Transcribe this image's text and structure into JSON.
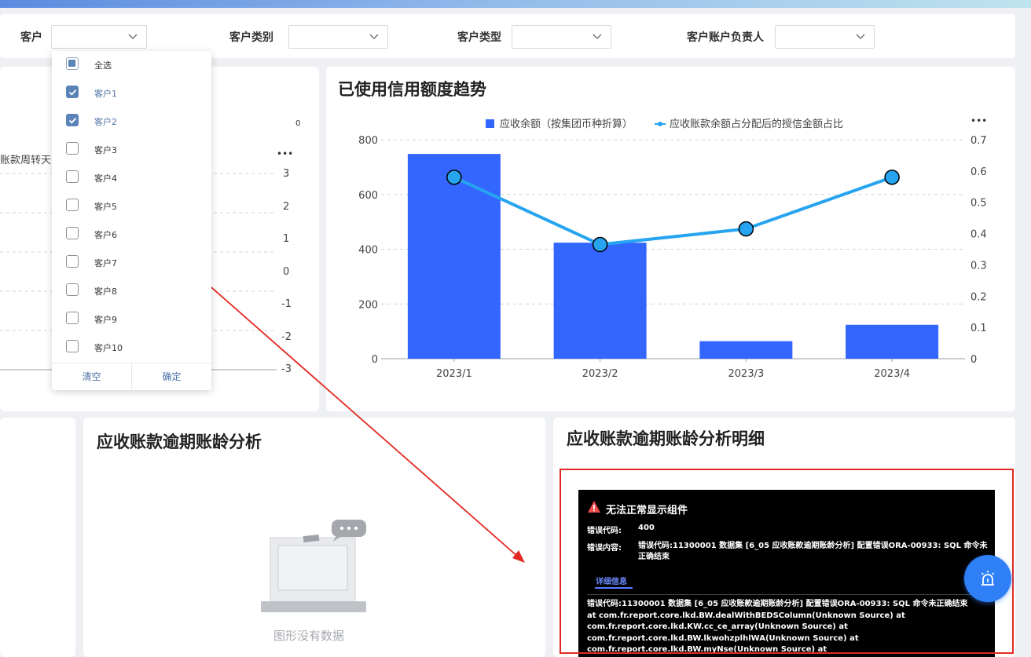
{
  "filters": {
    "customer_label": "客户",
    "category_label": "客户类别",
    "type_label": "客户类型",
    "owner_label": "客户账户负责人"
  },
  "dropdown": {
    "select_all": "全选",
    "items": [
      {
        "label": "客户1",
        "checked": true
      },
      {
        "label": "客户2",
        "checked": true
      },
      {
        "label": "客户3",
        "checked": false
      },
      {
        "label": "客户4",
        "checked": false
      },
      {
        "label": "客户5",
        "checked": false
      },
      {
        "label": "客户6",
        "checked": false
      },
      {
        "label": "客户7",
        "checked": false
      },
      {
        "label": "客户8",
        "checked": false
      },
      {
        "label": "客户9",
        "checked": false
      },
      {
        "label": "客户10",
        "checked": false
      }
    ],
    "clear_label": "清空",
    "confirm_label": "确定"
  },
  "left_chart": {
    "corner_value": "0",
    "axis_label_partial": "账款周转天",
    "more": "•••",
    "right_ticks": [
      "3",
      "2",
      "1",
      "0",
      "-1",
      "-2",
      "-3"
    ]
  },
  "credit_chart": {
    "title": "已使用信用额度趋势",
    "more": "•••",
    "chart_data": {
      "type": "bar",
      "categories": [
        "2023/1",
        "2023/2",
        "2023/3",
        "2023/4"
      ],
      "series": [
        {
          "name": "应收余额（按集团币种折算）",
          "type": "bar",
          "axis": "left",
          "values": [
            748,
            424,
            64,
            124
          ]
        },
        {
          "name": "应收账款余额占分配后的授信金额占比",
          "type": "line",
          "axis": "right",
          "values": [
            0.58,
            0.365,
            0.415,
            0.58
          ]
        }
      ],
      "y_left": {
        "ticks": [
          "0",
          "200",
          "400",
          "600",
          "800"
        ],
        "range": [
          0,
          800
        ]
      },
      "y_right": {
        "ticks": [
          "0",
          "0.1",
          "0.2",
          "0.3",
          "0.4",
          "0.5",
          "0.6",
          "0.7"
        ],
        "range": [
          0,
          0.7
        ]
      },
      "grid": true,
      "legend": "top",
      "colors": {
        "bar": "#3366ff",
        "line": "#26a4f0"
      }
    }
  },
  "aging_card": {
    "title": "应收账款逾期账龄分析",
    "empty_text": "图形没有数据"
  },
  "detail_card": {
    "title": "应收账款逾期账龄分析明细",
    "error": {
      "heading": "无法正常显示组件",
      "code_label": "错误代码:",
      "code_value": "400",
      "content_label": "错误内容:",
      "content_value": "错误代码:11300001 数据集 [6_05 应收账款逾期账龄分析] 配置错误ORA-00933: SQL 命令未正确结束",
      "tab_label": "详细信息",
      "detail_lines": [
        "错误代码:11300001 数据集 [6_05 应收账款逾期账龄分析] 配置错误ORA-00933: SQL 命令未正确结束",
        "at com.fr.report.core.lkd.BW.dealWithBEDSColumn(Unknown Source) at",
        "com.fr.report.core.lkd.KW.cc_ce_array(Unknown Source) at",
        "com.fr.report.core.lkd.BW.lkwohzplhlWA(Unknown Source) at",
        "com.fr.report.core.lkd.BW.myNse(Unknown Source) at"
      ]
    }
  }
}
